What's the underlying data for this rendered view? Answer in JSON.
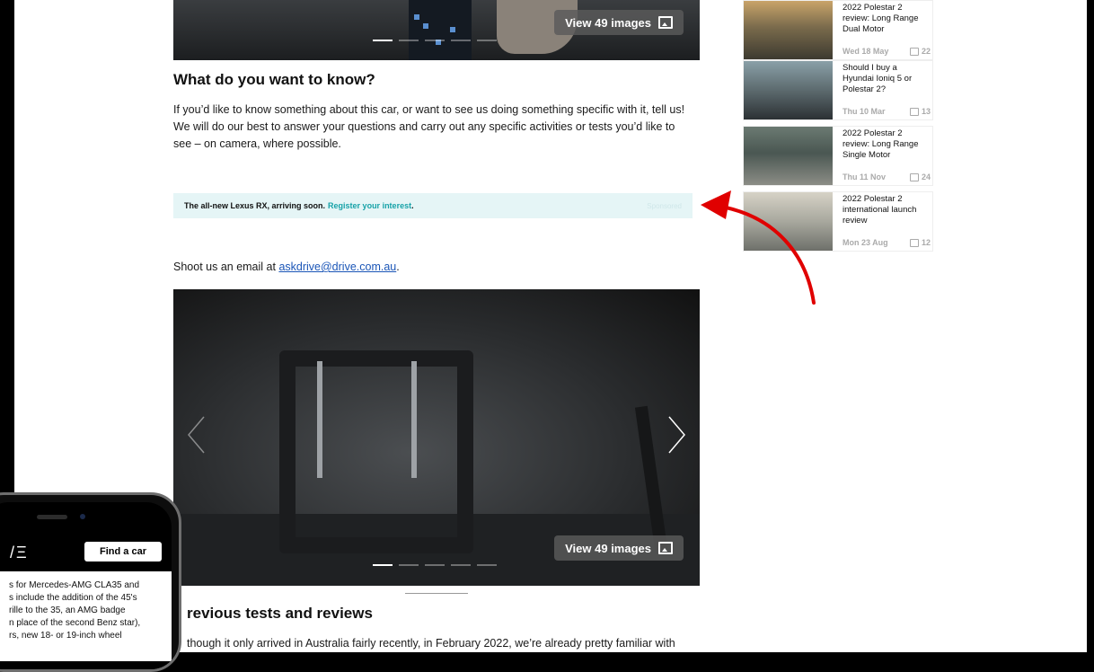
{
  "top_gallery": {
    "view_label": "View 49 images"
  },
  "section1": {
    "heading": "What do you want to know?",
    "body": "If you’d like to know something about this car, or want to see us doing something specific with it, tell us! We will do our best to answer your questions and carry out any specific activities or tests you’d like to see – on camera, where possible."
  },
  "sponsor": {
    "lead": "The all-new Lexus RX, arriving soon.",
    "link": "Register your interest",
    "after": " .",
    "tag": "Sponsored"
  },
  "email": {
    "prefix": "Shoot us an email at ",
    "address": "askdrive@drive.com.au",
    "suffix": "."
  },
  "main_gallery": {
    "view_label": "View 49 images"
  },
  "section2": {
    "heading": "revious tests and reviews",
    "body": "though it only arrived in Australia fairly recently, in February 2022, we’re already pretty familiar with"
  },
  "sidebar": {
    "items": [
      {
        "title": "2022 Polestar 2 review: Long Range Dual Motor",
        "date": "Wed 18 May",
        "comments": "22"
      },
      {
        "title": "Should I buy a Hyundai Ioniq 5 or Polestar 2?",
        "date": "Thu 10 Mar",
        "comments": "13"
      },
      {
        "title": "2022 Polestar 2 review: Long Range Single Motor",
        "date": "Thu 11 Nov",
        "comments": "24"
      },
      {
        "title": "2022 Polestar 2 international launch review",
        "date": "Mon 23 Aug",
        "comments": "12"
      }
    ]
  },
  "phone": {
    "logo": "/Ξ",
    "find_car": "Find a car",
    "lines": [
      "s for Mercedes-AMG CLA35 and",
      "s include the addition of the 45's",
      "rille to the 35, an AMG badge",
      "n place of the second Benz star),",
      "rs, new 18- or 19-inch wheel"
    ]
  },
  "colors": {
    "annotation_arrow": "#e00000",
    "sponsor_link": "#17a2a8",
    "email_link": "#1a55b7"
  }
}
